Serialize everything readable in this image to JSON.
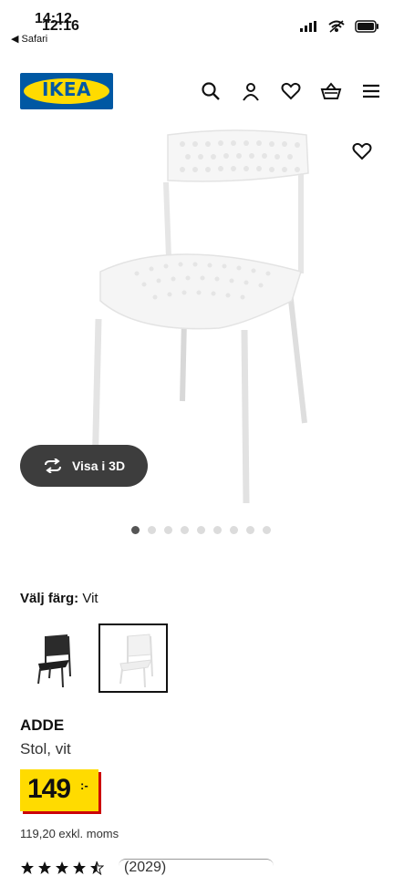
{
  "status_bar": {
    "time_under": "14:12",
    "time_over": "12:16",
    "back_label": "◀ Safari"
  },
  "header": {
    "logo_text": "IKEA",
    "icons": [
      "search-icon",
      "user-icon",
      "heart-icon",
      "basket-icon",
      "menu-icon"
    ]
  },
  "gallery": {
    "view_3d_label": "Visa i 3D",
    "dot_count": 9,
    "active_dot": 0
  },
  "color_selector": {
    "label": "Välj färg:",
    "selected_value": "Vit",
    "options": [
      "black",
      "white"
    ],
    "selected_option": "white"
  },
  "product": {
    "name": "ADDE",
    "description": "Stol, vit",
    "price_int": "149",
    "price_suffix": ":-",
    "excl_vat": "119,20 exkl. moms",
    "rating": 4.5,
    "review_count": "(2029)"
  },
  "colors": {
    "ikea_blue": "#0058a3",
    "ikea_yellow": "#ffdb00",
    "price_shadow": "#cc0008"
  }
}
